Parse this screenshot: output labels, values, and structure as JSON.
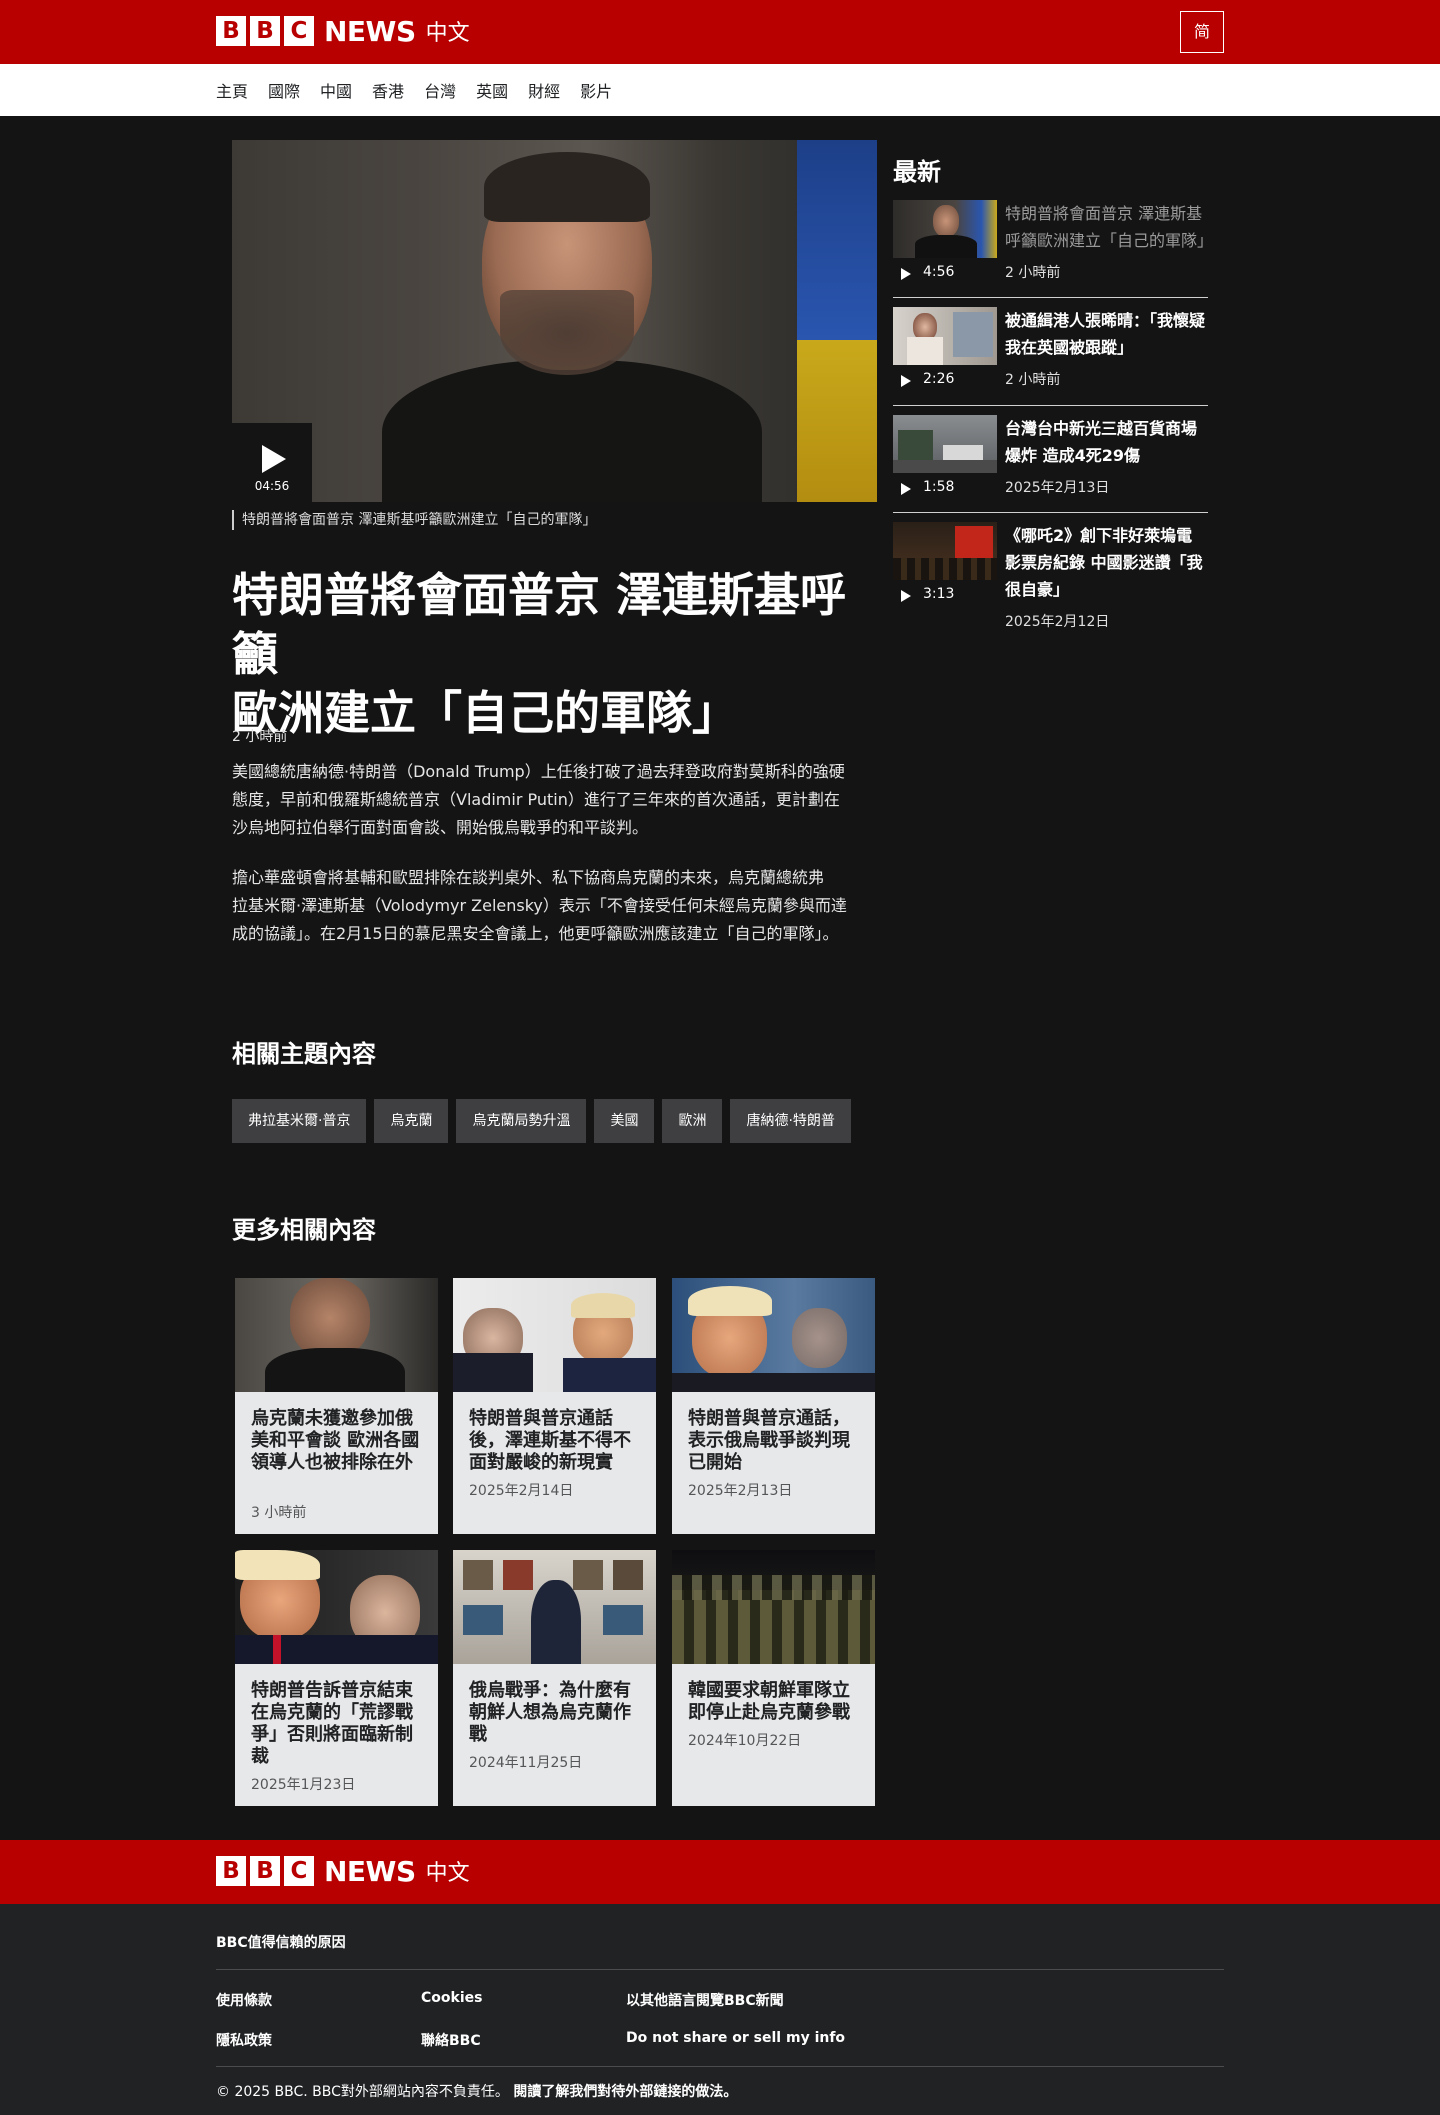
{
  "header": {
    "logo_letters": [
      "B",
      "B",
      "C"
    ],
    "logo_news": "NEWS",
    "logo_lang": "中文",
    "lang_toggle": "简"
  },
  "nav": {
    "items": [
      "主頁",
      "國際",
      "中國",
      "香港",
      "台灣",
      "英國",
      "財經",
      "影片"
    ]
  },
  "hero": {
    "video_duration": "04:56",
    "caption": "特朗普將會面普京 澤連斯基呼籲歐洲建立「自己的軍隊」"
  },
  "article": {
    "headline_line1": "特朗普將會面普京 澤連斯基呼籲",
    "headline_line2": "歐洲建立「自己的軍隊」",
    "timestamp": "2 小時前",
    "para1_line1": "美國總統唐納德·特朗普（Donald Trump）上任後打破了過去拜登政府對莫斯科的強硬",
    "para1_line2": "態度，早前和俄羅斯總統普京（Vladimir Putin）進行了三年來的首次通話，更計劃在",
    "para1_line3": "沙烏地阿拉伯舉行面對面會談、開始俄烏戰爭的和平談判。",
    "para2_line1": "擔心華盛頓會將基輔和歐盟排除在談判桌外、私下協商烏克蘭的未來，烏克蘭總統弗",
    "para2_line2": "拉基米爾·澤連斯基（Volodymyr Zelensky）表示「不會接受任何未經烏克蘭參與而達",
    "para2_line3": "成的協議」。在2月15日的慕尼黑安全會議上，他更呼籲歐洲應該建立「自己的軍隊」。"
  },
  "related": {
    "title": "相關主題內容",
    "tags": [
      "弗拉基米爾·普京",
      "烏克蘭",
      "烏克蘭局勢升溫",
      "美國",
      "歐洲",
      "唐納德·特朗普"
    ]
  },
  "more": {
    "title": "更多相關內容",
    "cards": [
      {
        "title": "烏克蘭未獲邀參加俄美和平會談 歐洲各國領導人也被排除在外",
        "date": "3 小時前"
      },
      {
        "title": "特朗普與普京通話後，澤連斯基不得不面對嚴峻的新現實",
        "date": "2025年2月14日"
      },
      {
        "title": "特朗普與普京通話，表示俄烏戰爭談判現已開始",
        "date": "2025年2月13日"
      },
      {
        "title": "特朗普告訴普京結束在烏克蘭的「荒謬戰爭」否則將面臨新制裁",
        "date": "2025年1月23日"
      },
      {
        "title": "俄烏戰爭：為什麼有朝鮮人想為烏克蘭作戰",
        "date": "2024年11月25日"
      },
      {
        "title": "韓國要求朝鮮軍隊立即停止赴烏克蘭參戰",
        "date": "2024年10月22日"
      }
    ]
  },
  "latest": {
    "title": "最新",
    "items": [
      {
        "title": "特朗普將會面普京 澤連斯基呼籲歐洲建立「自己的軍隊」",
        "duration": "4:56",
        "date": "2 小時前"
      },
      {
        "title": "被通緝港人張晞晴：「我懷疑我在英國被跟蹤」",
        "duration": "2:26",
        "date": "2 小時前"
      },
      {
        "title": "台灣台中新光三越百貨商場爆炸 造成4死29傷",
        "duration": "1:58",
        "date": "2025年2月13日"
      },
      {
        "title": "《哪吒2》創下非好萊塢電影票房紀錄 中國影迷讚「我很自豪」",
        "duration": "3:13",
        "date": "2025年2月12日"
      }
    ]
  },
  "footer": {
    "trust_link": "BBC值得信賴的原因",
    "terms": "使用條款",
    "cookies": "Cookies",
    "other_lang": "以其他語言閱覽BBC新聞",
    "privacy": "隱私政策",
    "contact": "聯絡BBC",
    "do_not_share": "Do not share or sell my info",
    "copyright": "© 2025 BBC. BBC對外部網站內容不負責任。",
    "external_link": "閱讀了解我們對待外部鏈接的做法。"
  }
}
